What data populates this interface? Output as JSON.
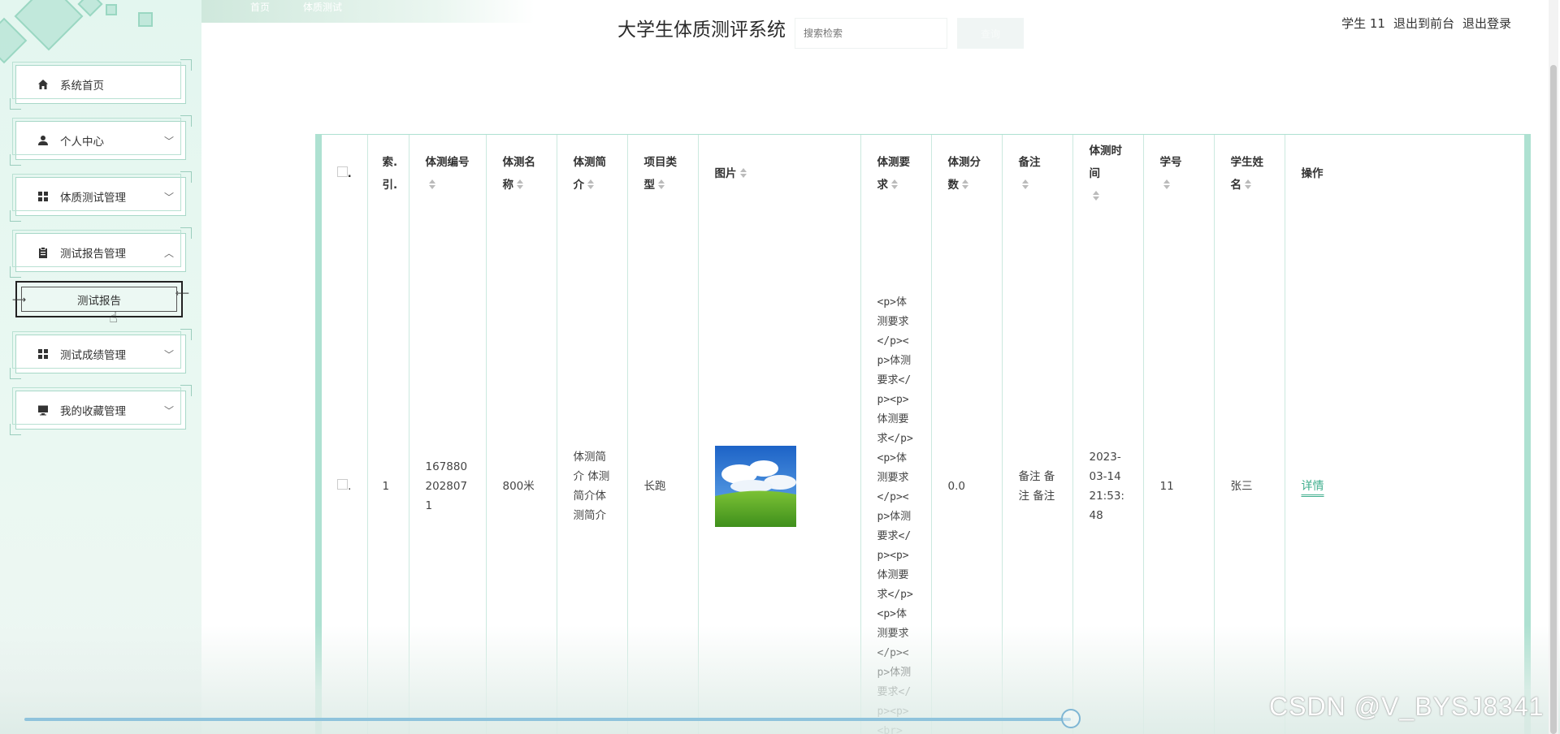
{
  "header": {
    "title": "大学生体质测评系统",
    "breadcrumb": [
      "首页",
      "体质测试"
    ],
    "search_placeholder": "搜索检索",
    "search_button": "查询",
    "user_name": "学生 11",
    "back_to_front": "退出到前台",
    "logout": "退出登录"
  },
  "sidebar": {
    "items": [
      {
        "label": "系统首页",
        "icon": "home-icon",
        "expanded": null
      },
      {
        "label": "个人中心",
        "icon": "user-icon",
        "expanded": false
      },
      {
        "label": "体质测试管理",
        "icon": "grid-icon",
        "expanded": false
      },
      {
        "label": "测试报告管理",
        "icon": "clipboard-icon",
        "expanded": true
      },
      {
        "label": "测试成绩管理",
        "icon": "grid-icon",
        "expanded": false
      },
      {
        "label": "我的收藏管理",
        "icon": "monitor-icon",
        "expanded": false
      }
    ],
    "active_submenu": "测试报告"
  },
  "table": {
    "headers": [
      "索引",
      "体测编号",
      "体测名称",
      "体测简介",
      "项目类型",
      "图片",
      "体测要求",
      "体测分数",
      "备注",
      "体测时间",
      "学号",
      "学生姓名",
      "操作"
    ],
    "header_display": [
      "索.引.",
      "体测编号",
      "体测名称",
      "体测简介",
      "项目类型",
      "图片",
      "体测要求",
      "体测分数",
      "备注",
      "体测时间",
      "学号",
      "学生姓名",
      "操作"
    ],
    "rows": [
      {
        "index": "1",
        "code": "1678802028071",
        "name": "800米",
        "intro": "体测简介 体测简介体测简介",
        "type": "长跑",
        "image": "green-field-blue-sky",
        "requirement": "<p>体测要求</p><p>体测要求</p><p>体测要求</p><p>体测要求</p><p>体测要求</p><p>体测要求</p><p>体测要求</p><p>体测要求</p><p><br></p>",
        "score": "0.0",
        "note": "备注 备注 备注",
        "time": "2023-03-14 21:53:48",
        "student_id": "11",
        "student_name": "张三",
        "action": "详情"
      }
    ]
  },
  "watermark": "CSDN @V_BYSJ8341",
  "colors": {
    "accent": "#aee1d1",
    "link": "#3fae8d",
    "sidebar_bg": "#e3f6ef"
  }
}
